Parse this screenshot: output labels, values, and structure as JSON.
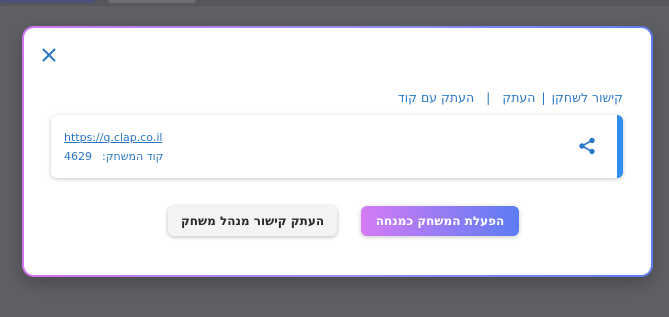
{
  "modal": {
    "links": {
      "player_link_label": "קישור לשחקן",
      "separator": "|",
      "copy_label": "העתק",
      "copy_with_code_label": "העתק עם קוד"
    },
    "card": {
      "url": "https://q.clap.co.il",
      "code_label": "קוד המשחק:",
      "code_value": "4629"
    },
    "buttons": {
      "start_as_host": "הפעלת המשחק כמנחה",
      "copy_host_link": "העתק קישור מנהל משחק"
    }
  },
  "icons": {
    "close": "close-icon",
    "share": "share-icon"
  },
  "colors": {
    "link": "#2b78c8",
    "accent_blue": "#2d8ff0",
    "gradient_start": "#d47bf5",
    "gradient_end": "#5c7cf5",
    "backdrop": "#5f6064"
  }
}
